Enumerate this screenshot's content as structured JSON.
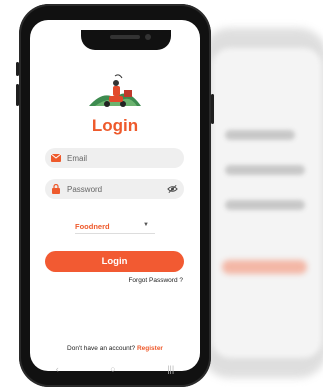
{
  "colors": {
    "accent": "#f25a32",
    "title": "#ee5a2c",
    "field_bg": "#efefef",
    "phone_body": "#111111"
  },
  "login": {
    "title": "Login",
    "email_placeholder": "Email",
    "email_icon": "envelope-icon",
    "password_placeholder": "Password",
    "password_icon": "lock-icon",
    "password_toggle_icon": "eye-off-icon",
    "role_select_value": "Foodnerd",
    "login_button": "Login",
    "forgot_password": "Forgot Password ?",
    "no_account_text": "Don't have an account?",
    "register_link": "Register"
  },
  "navbar": {
    "back": "‹",
    "home": "○",
    "recent": "|||"
  }
}
